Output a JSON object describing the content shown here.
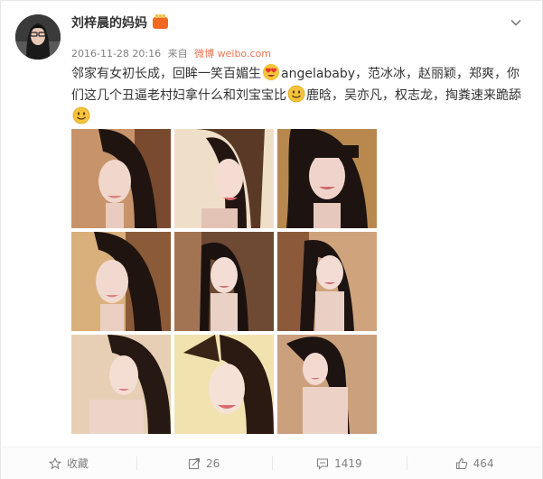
{
  "post": {
    "username": "刘梓晨的妈妈",
    "vip_badge_label": "",
    "timestamp": "2016-11-28 20:16",
    "source_prefix": "来自",
    "source_client": "微博 weibo.com",
    "text_segments": [
      "邻家有女初长成，回眸一笑百媚生",
      "angelababy，范冰冰，赵丽颖，郑爽，你们这几个丑逼老村妇拿什么和刘宝宝比",
      "鹿晗，吴亦凡，权志龙，掏粪速来跪舔"
    ],
    "emojis": [
      "love-eyes-emoji",
      "smile-emoji",
      "smile-emoji"
    ],
    "photo_count": 9
  },
  "actions": {
    "favorite_label": "收藏",
    "repost_count": "26",
    "comment_count": "1419",
    "like_count": "464"
  },
  "icons": {
    "menu": "chevron-down-icon",
    "favorite": "star-icon",
    "repost": "repost-icon",
    "comment": "comment-icon",
    "like": "thumbs-up-icon"
  },
  "colors": {
    "text": "#333333",
    "meta": "#808080",
    "source": "#eb7350",
    "badge": "#f26a21",
    "emoji": "#f5c33b"
  }
}
